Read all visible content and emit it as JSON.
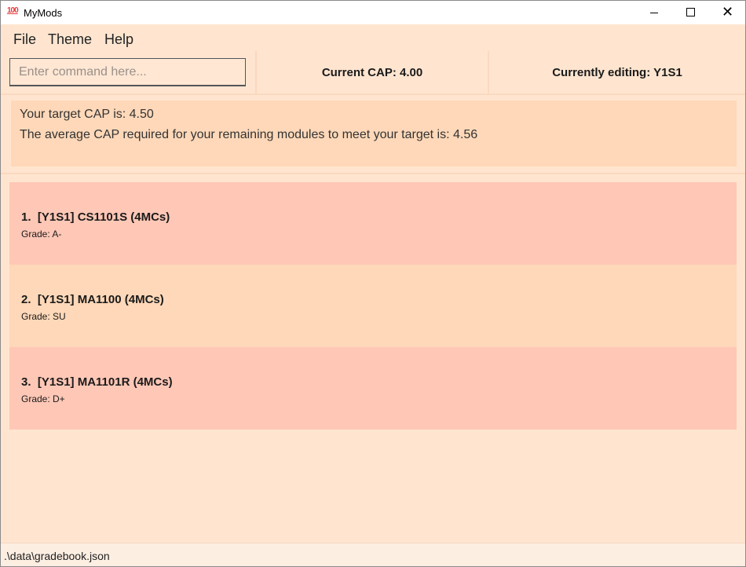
{
  "window": {
    "title": "MyMods",
    "icon": "hundred-points-icon",
    "icon_text": "100"
  },
  "menu": [
    "File",
    "Theme",
    "Help"
  ],
  "command": {
    "placeholder": "Enter command here...",
    "value": ""
  },
  "cap": {
    "label": "Current CAP: 4.00"
  },
  "editing": {
    "label": "Currently editing: Y1S1"
  },
  "target": {
    "line1": "Your target CAP is: 4.50",
    "line2": "The average CAP required for your remaining modules to meet your target is: 4.56"
  },
  "modules": [
    {
      "index": "1.",
      "title": "[Y1S1] CS1101S (4MCs)",
      "grade": "Grade: A-",
      "color": "#ffc7b6"
    },
    {
      "index": "2.",
      "title": "[Y1S1] MA1100 (4MCs)",
      "grade": "Grade: SU",
      "color": "#fed8b8"
    },
    {
      "index": "3.",
      "title": "[Y1S1] MA1101R (4MCs)",
      "grade": "Grade: D+",
      "color": "#ffc7b6"
    }
  ],
  "status": {
    "path": ".\\data\\gradebook.json"
  },
  "colors": {
    "background": "#ffe5d0",
    "panel": "#fed8b8",
    "card_red": "#ffc7b6",
    "card_orange": "#fed8b8"
  }
}
